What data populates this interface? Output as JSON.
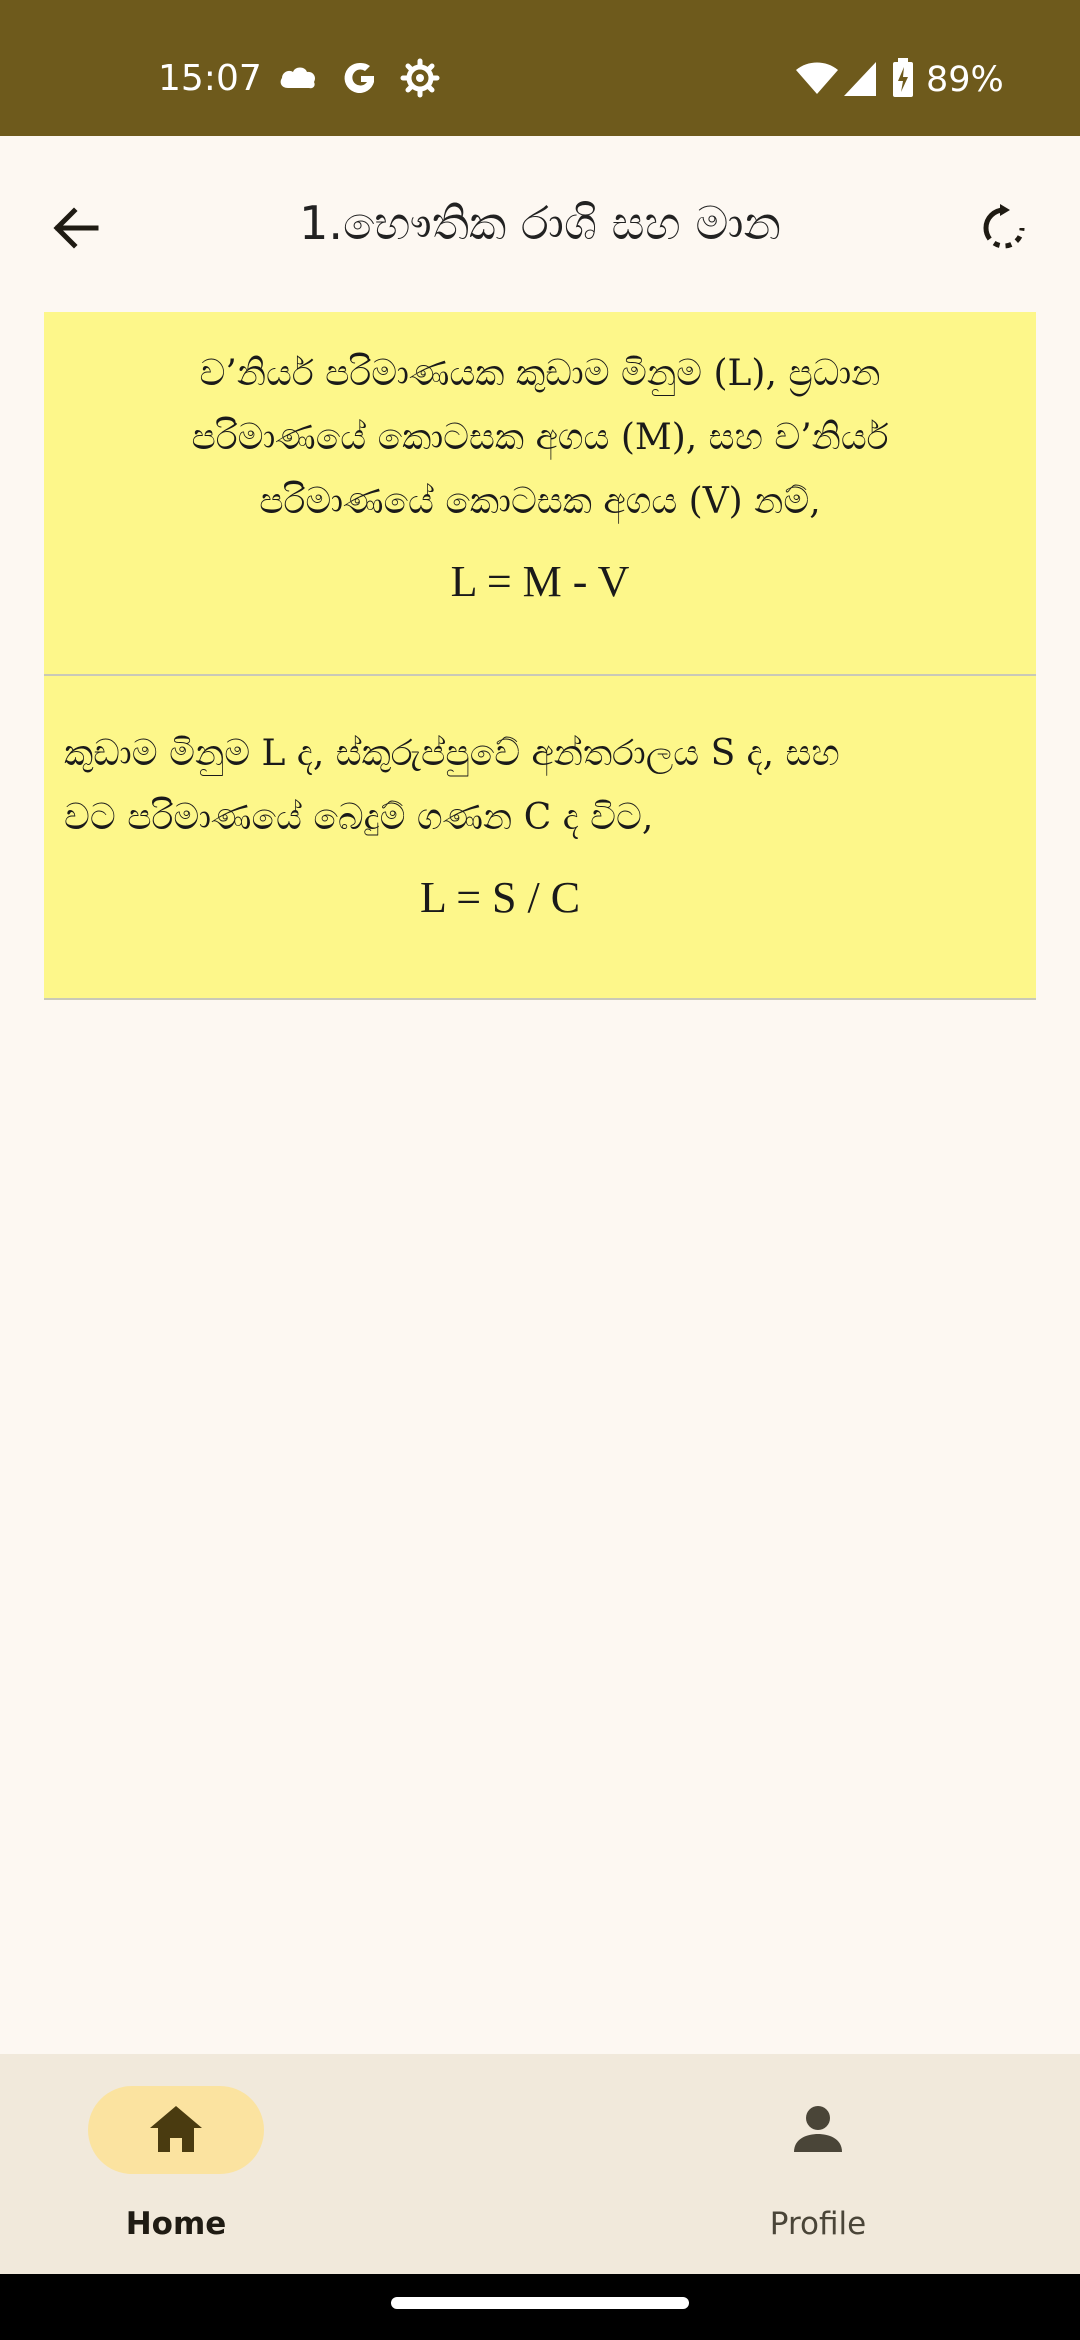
{
  "status_bar": {
    "time": "15:07",
    "battery_percent": "89%",
    "icons": [
      "cloud-icon",
      "google-icon",
      "settings-gear-icon",
      "wifi-icon",
      "cell-signal-icon",
      "battery-charging-icon"
    ]
  },
  "app_bar": {
    "title": "1.භෞතික රාශි සහ මාන",
    "back_icon": "arrow-back-icon",
    "refresh_icon": "refresh-icon"
  },
  "cards": [
    {
      "lines": [
        "ව’නියර් පරිමාණයක කුඩාම මිනුම (L), ප්‍රධාන",
        "පරිමාණයේ කොටසක අගය (M), සහ ව’නියර්",
        "පරිමාණයේ කොටසක අගය (V) නම්,"
      ],
      "formula": "L = M - V"
    },
    {
      "lines": [
        "කුඩාම මිනුම L ද, ස්කුරුප්පුවේ අන්තරාලය S ද, සහ",
        "වට පරිමාණයේ බෙදුම් ගණන C ද විට,"
      ],
      "formula": "L = S / C"
    }
  ],
  "bottom_nav": {
    "items": [
      {
        "label": "Home",
        "icon": "home-icon",
        "active": true
      },
      {
        "label": "Profile",
        "icon": "person-icon",
        "active": false
      }
    ]
  },
  "colors": {
    "status_bar": "#6e5a1c",
    "background": "#fdf8f2",
    "card": "#fdf78a",
    "nav_background": "#f1e9db",
    "nav_active_pill": "#fbe3a0",
    "nav_icon": "#4a3b10"
  }
}
